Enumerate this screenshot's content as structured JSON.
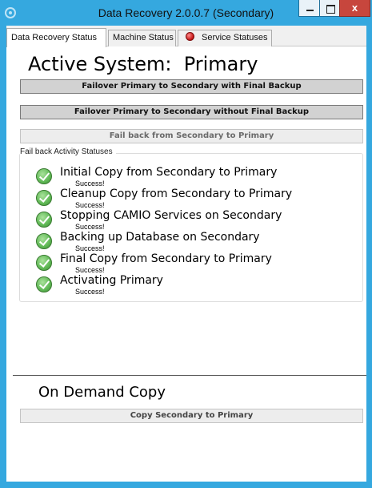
{
  "window": {
    "title": "Data Recovery 2.0.0.7 (Secondary)",
    "close_glyph": "x",
    "accent_color": "#35a8df"
  },
  "tabs": [
    {
      "label": "Data Recovery Status",
      "selected": true
    },
    {
      "label": "Machine Status",
      "selected": false
    },
    {
      "label": "Service Statuses",
      "selected": false,
      "icon": "red-status-dot-icon"
    }
  ],
  "active_system": {
    "text": "Active System:  Primary"
  },
  "actions": {
    "failover_with_backup": "Failover Primary to Secondary with Final Backup",
    "failover_without_backup": "Failover Primary to Secondary without Final Backup",
    "fail_back": "Fail back from Secondary to Primary",
    "fail_back_enabled": false
  },
  "fail_back_statuses": {
    "title": "Fail back Activity Statuses",
    "items": [
      {
        "label": "Initial Copy from Secondary to Primary",
        "status": "Success!",
        "icon": "green-check-icon"
      },
      {
        "label": "Cleanup Copy from Secondary to Primary",
        "status": "Success!",
        "icon": "green-check-icon"
      },
      {
        "label": "Stopping CAMIO Services on Secondary",
        "status": "Success!",
        "icon": "green-check-icon"
      },
      {
        "label": "Backing up Database on Secondary",
        "status": "Success!",
        "icon": "green-check-icon"
      },
      {
        "label": "Final Copy from Secondary to Primary",
        "status": "Success!",
        "icon": "green-check-icon"
      },
      {
        "label": "Activating Primary",
        "status": "Success!",
        "icon": "green-check-icon"
      }
    ]
  },
  "on_demand": {
    "title": "On Demand Copy",
    "button_label": "Copy Secondary to Primary",
    "button_enabled": false
  }
}
